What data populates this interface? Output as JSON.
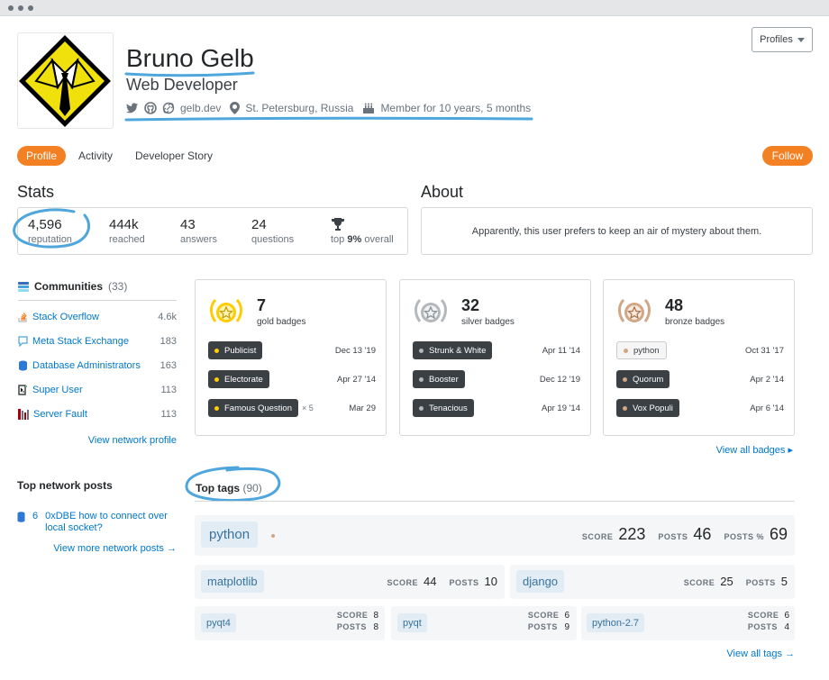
{
  "user": {
    "name": "Bruno Gelb",
    "title": "Web Developer",
    "website": "gelb.dev",
    "location": "St. Petersburg, Russia",
    "member_since": "Member for 10 years, 5 months"
  },
  "header": {
    "profiles_label": "Profiles"
  },
  "tabs": [
    {
      "label": "Profile",
      "active": true
    },
    {
      "label": "Activity",
      "active": false
    },
    {
      "label": "Developer Story",
      "active": false
    }
  ],
  "follow_label": "Follow",
  "stats": {
    "heading": "Stats",
    "items": [
      {
        "value": "4,596",
        "label": "reputation"
      },
      {
        "value": "444k",
        "label": "reached"
      },
      {
        "value": "43",
        "label": "answers"
      },
      {
        "value": "24",
        "label": "questions"
      }
    ],
    "rank": {
      "prefix": "top",
      "value": "9%",
      "suffix": "overall"
    }
  },
  "about": {
    "heading": "About",
    "text": "Apparently, this user prefers to keep an air of mystery about them."
  },
  "communities": {
    "title": "Communities",
    "count": "(33)",
    "items": [
      {
        "name": "Stack Overflow",
        "rep": "4.6k",
        "icon": "stack-overflow-icon"
      },
      {
        "name": "Meta Stack Exchange",
        "rep": "183",
        "icon": "meta-icon"
      },
      {
        "name": "Database Administrators",
        "rep": "163",
        "icon": "database-icon"
      },
      {
        "name": "Super User",
        "rep": "113",
        "icon": "super-user-icon"
      },
      {
        "name": "Server Fault",
        "rep": "113",
        "icon": "server-fault-icon"
      }
    ],
    "view_link": "View network profile"
  },
  "badges": {
    "gold": {
      "count": "7",
      "label": "gold badges",
      "color": "#ffcc01",
      "items": [
        {
          "name": "Publicist",
          "date": "Dec 13 '19",
          "times": ""
        },
        {
          "name": "Electorate",
          "date": "Apr 27 '14",
          "times": ""
        },
        {
          "name": "Famous Question",
          "date": "Mar 29",
          "times": "× 5"
        }
      ]
    },
    "silver": {
      "count": "32",
      "label": "silver badges",
      "color": "#b4b8bc",
      "items": [
        {
          "name": "Strunk & White",
          "date": "Apr 11 '14",
          "times": ""
        },
        {
          "name": "Booster",
          "date": "Dec 12 '19",
          "times": ""
        },
        {
          "name": "Tenacious",
          "date": "Apr 19 '14",
          "times": ""
        }
      ]
    },
    "bronze": {
      "count": "48",
      "label": "bronze badges",
      "color": "#d1a684",
      "items": [
        {
          "name": "python",
          "date": "Oct 31 '17",
          "times": ""
        },
        {
          "name": "Quorum",
          "date": "Apr 2 '14",
          "times": ""
        },
        {
          "name": "Vox Populi",
          "date": "Apr 6 '14",
          "times": ""
        }
      ]
    },
    "view_all": "View all badges ▸"
  },
  "network_posts": {
    "title": "Top network posts",
    "items": [
      {
        "score": "6",
        "title": "0xDBE how to connect over local socket?"
      }
    ],
    "view_more": "View more network posts →"
  },
  "top_tags": {
    "title": "Top tags",
    "count": "(90)",
    "score_label": "SCORE",
    "posts_label": "POSTS",
    "posts_pct_label": "POSTS %",
    "main": {
      "name": "python",
      "score": "223",
      "posts": "46",
      "posts_pct": "69"
    },
    "second": [
      {
        "name": "matplotlib",
        "score": "44",
        "posts": "10"
      },
      {
        "name": "django",
        "score": "25",
        "posts": "5"
      }
    ],
    "third": [
      {
        "name": "pyqt4",
        "score": "8",
        "posts": "8"
      },
      {
        "name": "pyqt",
        "score": "6",
        "posts": "9"
      },
      {
        "name": "python-2.7",
        "score": "6",
        "posts": "4"
      }
    ],
    "view_all": "View all tags →"
  },
  "colors": {
    "accent": "#f48024",
    "link": "#0077cc",
    "annotation": "#4ea6dc"
  }
}
